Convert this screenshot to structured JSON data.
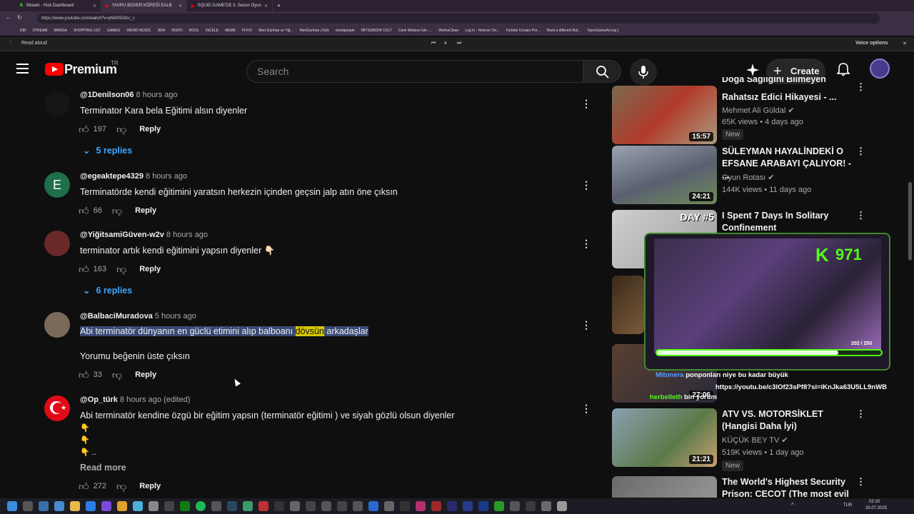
{
  "browser": {
    "tabs": [
      {
        "title": "Stream - Kick Dashboard"
      },
      {
        "title": "YAVRU BOXER KÖPEĞİ EALB"
      },
      {
        "title": "SQUID GAME'DE 3. Sezon Oyun"
      }
    ],
    "url": "https://www.youtube.com/watch?v=pNkPADtnc_c",
    "bookmarks": [
      "DIR",
      "STREAM",
      "MANGA",
      "SHOPPING LIST",
      "GAMES",
      "WEIRD MUSIC",
      "JIRA",
      "INSPO",
      "ROOL",
      "INCELE",
      "MEME",
      "FFXIV",
      "Mert Günhan ve Yiğ...",
      "MertGunhan | Kick",
      "wiredpeople",
      "MITSUBISHI COLT",
      "Canlı Mobese İzle -...",
      "WeAreClean",
      "Log In - Hetzner On...",
      "Fortnite Creator Por...",
      "Want a different Buf...",
      "OpenGameArt.org |"
    ],
    "read_aloud": "Read aloud",
    "voice_options": "Voice options"
  },
  "header": {
    "logo": "Premium",
    "region": "TR",
    "search_placeholder": "Search",
    "create_label": "Create"
  },
  "comments": [
    {
      "author": "@1Denilson06",
      "time": "8 hours ago",
      "text": "Terminator Kara bela Eğitimi alsın diyenler",
      "likes": "197",
      "reply": "Reply",
      "replies": "5 replies"
    },
    {
      "author": "@egeaktepe4329",
      "time": "8 hours ago",
      "avatar_letter": "E",
      "text": "Terminatörde kendi eğitimini yaratsın herkezin içinden geçsin jalp atın öne çıksın",
      "likes": "66",
      "reply": "Reply"
    },
    {
      "author": "@YiğitsamiGüven-w2v",
      "time": "8 hours ago",
      "text": "terminator artık kendi eğitimini yapsın diyenler 👇🏻",
      "likes": "163",
      "reply": "Reply",
      "replies": "6 replies"
    },
    {
      "author": "@BalbaciMuradova",
      "time": "5 hours ago",
      "text_pre": "Abi terminatör dünyanın en güclü etimini alıp balboanı ",
      "text_hl": "dövsün",
      "text_post": " arkadaşlar",
      "text2": "Yorumu beğenin üste çıksın",
      "likes": "33",
      "reply": "Reply"
    },
    {
      "author": "@Op_türk",
      "time": "8 hours ago (edited)",
      "text": "Abi terminatör kendine özgü bir eğitim yapsın (terminatör eğitimi ) ve siyah gözlü olsun diyenler",
      "emoji1": "👇",
      "emoji2": "👇",
      "emoji3": "👇 ..",
      "read_more": "Read more",
      "likes": "272",
      "reply": "Reply"
    }
  ],
  "sidebar": [
    {
      "title_l1": "Doğa Sağlığını Bilmeyen",
      "title_l2": "Rahatsız Edici Hikayesi - ...",
      "channel": "Mehmet Ali Güldal",
      "meta": "65K views • 4 days ago",
      "badge": "New",
      "duration": "15:57"
    },
    {
      "title_l1": "SÜLEYMAN HAYALİNDEKİ O",
      "title_l2": "EFSANE ARABAYI ÇALIYOR! - ...",
      "channel": "Oyun Rotası",
      "meta": "144K views • 11 days ago",
      "duration": "24:21"
    },
    {
      "title_l1": "I Spent 7 Days In Solitary",
      "title_l2": "Confinement",
      "thumb_text": "DAY #5"
    },
    {
      "title_l1": "ATV VS. MOTORSİKLET",
      "title_l2": "(Hangisi Daha İyi)",
      "channel": "KÜÇÜK BEY TV",
      "meta": "519K views • 1 day ago",
      "badge": "New",
      "duration": "21:21"
    },
    {
      "title_l1": "The World's Highest Security",
      "title_l2": "Prison: CECOT (The most evil ..."
    }
  ],
  "sidebar_extra_durations": [
    "27:06"
  ],
  "overlay": {
    "viewer_count": "971",
    "progress_label": "202 / 250",
    "progress_fraction": 0.808,
    "chat": [
      {
        "user": "Mitonera",
        "msg": "ponponları niye bu kadar büyük"
      },
      {
        "user": "",
        "msg": "https://youtu.be/c3IOf23sPf8?si=iKnJka63U5LL9nWB"
      },
      {
        "user": "herbelleth",
        "msg": "bin yorum"
      }
    ]
  },
  "taskbar": {
    "lang": "TUR",
    "time": "02:10",
    "date": "25.07.2025"
  },
  "colors": {
    "accent": "#3ea6ff",
    "kick_green": "#53fc18",
    "highlight": "#3a4a75"
  }
}
